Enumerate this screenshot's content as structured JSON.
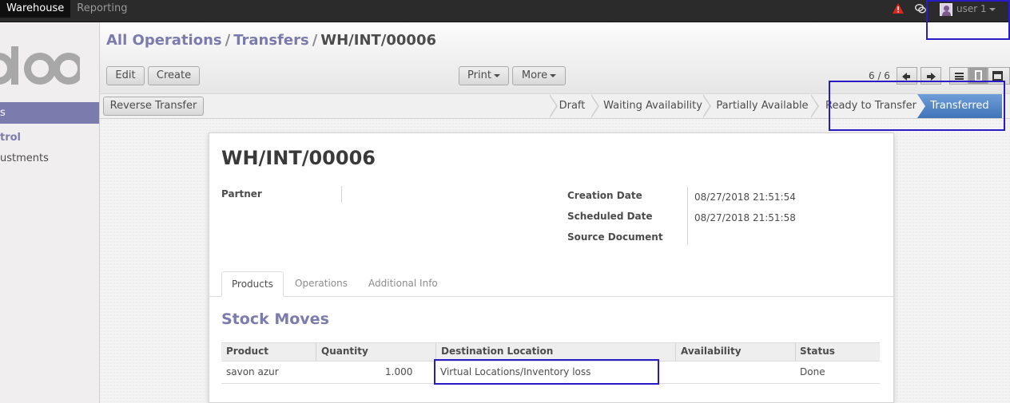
{
  "topbar": {
    "menus": [
      {
        "label": "Warehouse",
        "active": true
      },
      {
        "label": "Reporting",
        "active": false
      }
    ],
    "user_name": "user 1"
  },
  "sidebar": {
    "active_item": "s",
    "section_title": "trol",
    "item": "ustments"
  },
  "breadcrumb": {
    "items": [
      "All Operations",
      "Transfers"
    ],
    "current": "WH/INT/00006",
    "separator": "/"
  },
  "toolbar": {
    "edit_label": "Edit",
    "create_label": "Create",
    "print_label": "Print",
    "more_label": "More",
    "pager": "6 / 6",
    "reverse_label": "Reverse Transfer"
  },
  "statusbar": {
    "steps": [
      "Draft",
      "Waiting Availability",
      "Partially Available",
      "Ready to Transfer"
    ],
    "active_step": "Transferred",
    "active_color": "#4a7fc1"
  },
  "form": {
    "title": "WH/INT/00006",
    "partner_label": "Partner",
    "partner_value": "",
    "creation_date_label": "Creation Date",
    "creation_date_value": "08/27/2018 21:51:54",
    "scheduled_date_label": "Scheduled Date",
    "scheduled_date_value": "08/27/2018 21:51:58",
    "source_document_label": "Source Document",
    "source_document_value": ""
  },
  "tabs": [
    "Products",
    "Operations",
    "Additional Info"
  ],
  "stock_moves": {
    "title": "Stock Moves",
    "columns": [
      "Product",
      "Quantity",
      "Destination Location",
      "Availability",
      "Status"
    ],
    "rows": [
      {
        "product": "savon azur",
        "quantity": "1.000",
        "destination": "Virtual Locations/Inventory loss",
        "availability": "",
        "status": "Done"
      }
    ]
  },
  "colors": {
    "brand": "#7c7bad",
    "highlight": "#2a1cc4",
    "alert": "#e0261d"
  }
}
